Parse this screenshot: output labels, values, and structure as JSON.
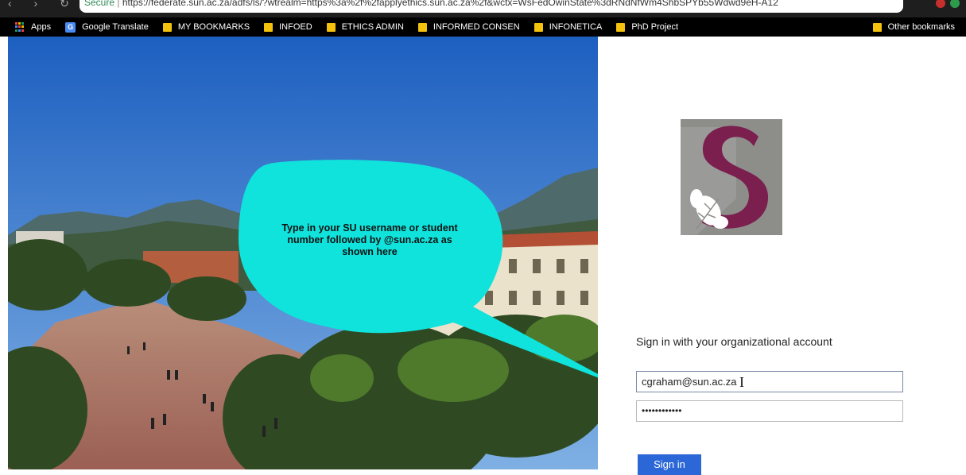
{
  "browser": {
    "url_secure_label": "Secure",
    "url_text": "https://federate.sun.ac.za/adfs/ls/?wtrealm=https%3a%2f%2fapplyethics.sun.ac.za%2f&wctx=WsFedOwinState%3dRNdNfWm4ShbSPYb55Wdwd9eH-A12"
  },
  "bookmarks": {
    "apps": "Apps",
    "items": [
      {
        "label": "Google Translate"
      },
      {
        "label": "MY BOOKMARKS"
      },
      {
        "label": "INFOED"
      },
      {
        "label": "ETHICS ADMIN"
      },
      {
        "label": "INFORMED CONSEN"
      },
      {
        "label": "INFONETICA"
      },
      {
        "label": "PhD Project"
      }
    ],
    "other": "Other bookmarks"
  },
  "callout": {
    "text": "Type in your SU username  or student number followed by @sun.ac.za as shown here"
  },
  "signin": {
    "title": "Sign in with your organizational account",
    "email_value": "cgraham@sun.ac.za",
    "password_mask": "••••••••••••",
    "button_label": "Sign in"
  },
  "colors": {
    "logo_grey": "#8d8d8a",
    "logo_maroon": "#7a1f4e",
    "callout_fill": "#0fe3dc",
    "button_blue": "#2b67d6"
  }
}
